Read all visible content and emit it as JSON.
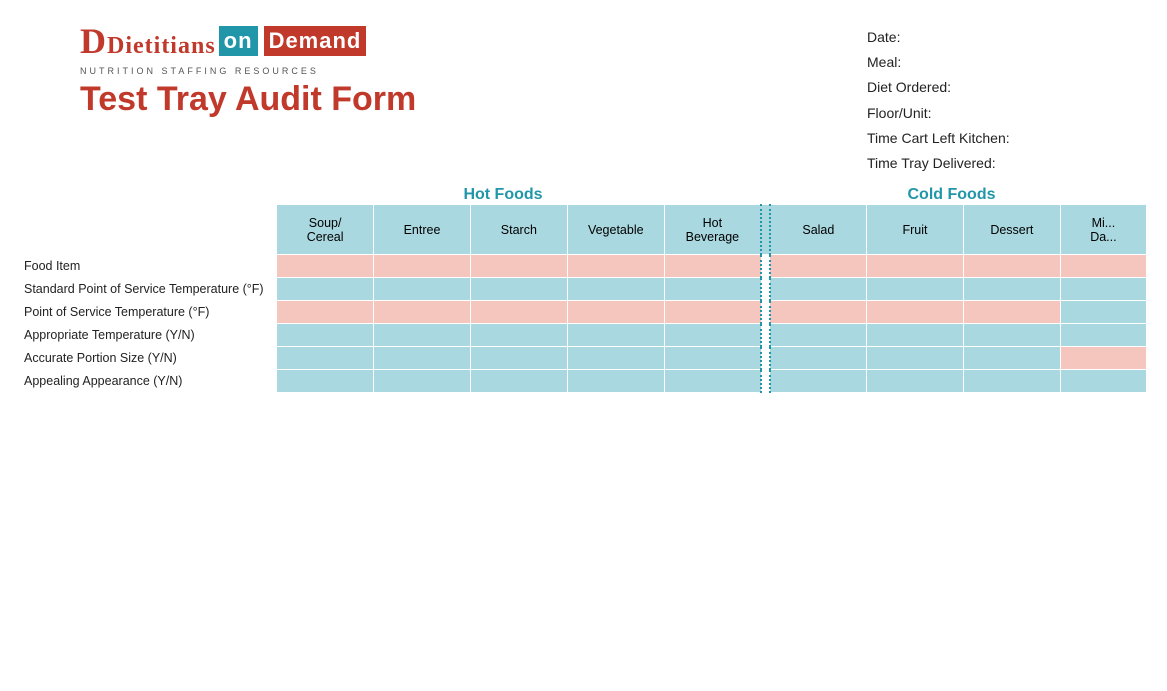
{
  "logo": {
    "dietitians": "Dietitians",
    "on": "on",
    "demand": "Demand",
    "subtitle": "NUTRITION   STAFFING   RESOURCES"
  },
  "form_title": "Test Tray Audit Form",
  "info": {
    "date_label": "Date:",
    "meal_label": "Meal:",
    "diet_label": "Diet Ordered:",
    "floor_label": "Floor/Unit:",
    "cart_label": "Time Cart Left Kitchen:",
    "tray_label": "Time Tray Delivered:"
  },
  "sections": {
    "hot": "Hot Foods",
    "cold": "Cold Foods"
  },
  "columns": {
    "hot": [
      "Soup/ Cereal",
      "Entree",
      "Starch",
      "Vegetable",
      "Hot Beverage"
    ],
    "cold": [
      "Salad",
      "Fruit",
      "Dessert",
      "Mi... Da..."
    ]
  },
  "rows": [
    {
      "label": "Food Item",
      "hot_type": "pink",
      "cold_type": "pink"
    },
    {
      "label": "Standard Point of Service Temperature (°F)",
      "hot_type": "blue",
      "cold_type": "blue"
    },
    {
      "label": "Point of Service Temperature (°F)",
      "hot_type": "pink",
      "cold_type": "pink"
    },
    {
      "label": "Appropriate Temperature (Y/N)",
      "hot_type": "blue",
      "cold_type": "blue"
    },
    {
      "label": "Accurate Portion Size (Y/N)",
      "hot_type": "blue",
      "cold_type": "blue"
    },
    {
      "label": "Appealing Appearance (Y/N)",
      "hot_type": "blue",
      "cold_type": "blue"
    }
  ]
}
